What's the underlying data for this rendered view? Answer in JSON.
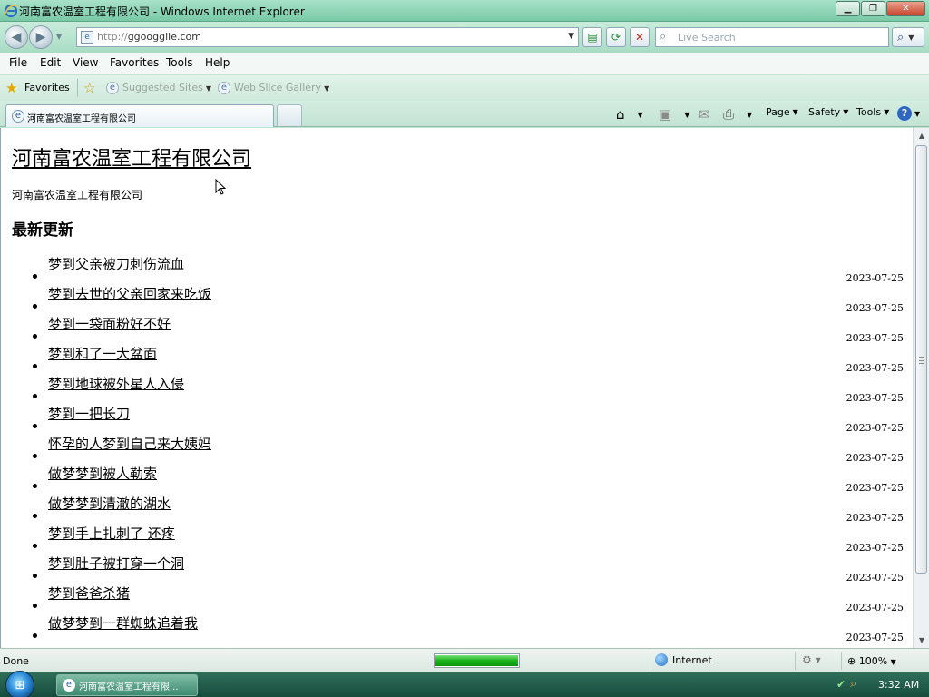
{
  "window": {
    "title": "河南富农温室工程有限公司 - Windows Internet Explorer",
    "buttons": {
      "minimize": "▁",
      "maximize": "❐",
      "close": "✕"
    }
  },
  "address": {
    "protocol": "http://",
    "url": "ggooggile.com",
    "search_placeholder": "Live Search"
  },
  "menu": [
    "File",
    "Edit",
    "View",
    "Favorites",
    "Tools",
    "Help"
  ],
  "favorites_bar": {
    "favorites_label": "Favorites",
    "links": [
      "Suggested Sites",
      "Web Slice Gallery"
    ]
  },
  "tabs": {
    "active_tab": "河南富农温室工程有限公司"
  },
  "command_bar": {
    "page": "Page",
    "safety": "Safety",
    "tools": "Tools"
  },
  "page": {
    "site_title": "河南富农温室工程有限公司",
    "site_description": "河南富农温室工程有限公司",
    "section_heading": "最新更新",
    "articles": [
      {
        "title": "梦到父亲被刀刺伤流血",
        "date": "2023-07-25"
      },
      {
        "title": "梦到去世的父亲回家来吃饭",
        "date": "2023-07-25"
      },
      {
        "title": "梦到一袋面粉好不好",
        "date": "2023-07-25"
      },
      {
        "title": "梦到和了一大盆面",
        "date": "2023-07-25"
      },
      {
        "title": "梦到地球被外星人入侵",
        "date": "2023-07-25"
      },
      {
        "title": "梦到一把长刀",
        "date": "2023-07-25"
      },
      {
        "title": "怀孕的人梦到自己来大姨妈",
        "date": "2023-07-25"
      },
      {
        "title": "做梦梦到被人勒索",
        "date": "2023-07-25"
      },
      {
        "title": "做梦梦到清澈的湖水",
        "date": "2023-07-25"
      },
      {
        "title": "梦到手上扎刺了 还疼",
        "date": "2023-07-25"
      },
      {
        "title": "梦到肚子被打穿一个洞",
        "date": "2023-07-25"
      },
      {
        "title": "梦到爸爸杀猪",
        "date": "2023-07-25"
      },
      {
        "title": "做梦梦到一群蜘蛛追着我",
        "date": "2023-07-25"
      }
    ]
  },
  "status": {
    "text": "Done",
    "progress": 1.0,
    "zone": "Internet",
    "zoom": "100%"
  },
  "taskbar": {
    "window_button": "河南富农温室工程有限...",
    "time": "3:32 AM"
  }
}
